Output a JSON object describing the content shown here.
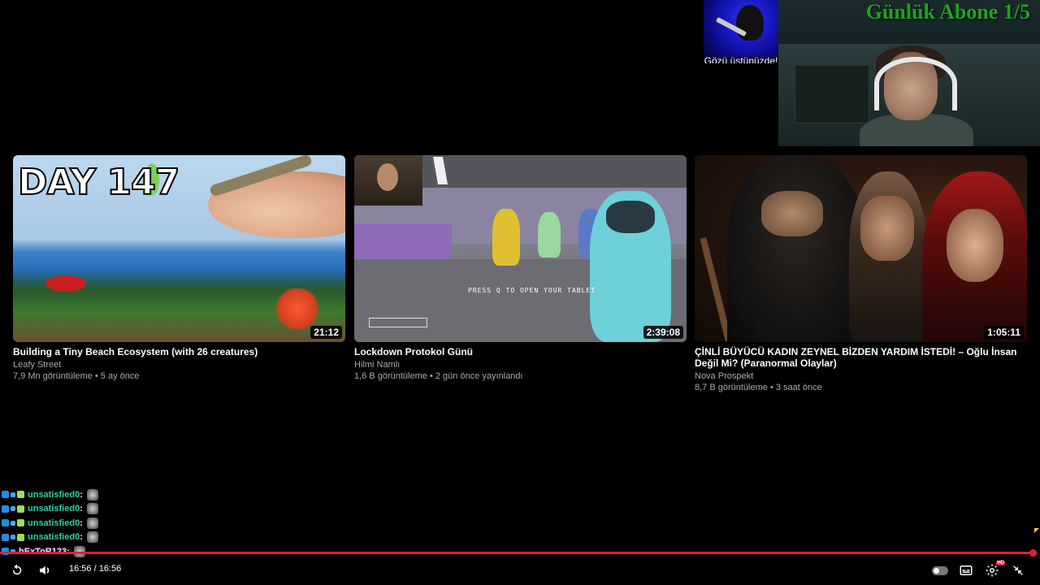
{
  "overlay": {
    "alert_caption": "Gözü üstünüzde!",
    "goal_text": "Günlük Abone 1/5"
  },
  "videos": [
    {
      "thumb_text": "DAY 147",
      "duration": "21:12",
      "title": "Building a Tiny Beach Ecosystem (with 26 creatures)",
      "channel": "Leafy Street",
      "meta": "7,9 Mn görüntüleme • 5 ay önce"
    },
    {
      "thumb_text": "PRESS Q TO OPEN YOUR TABLET",
      "duration": "2:39:08",
      "title": "Lockdown Protokol Günü",
      "channel": "Hilmi Namlı",
      "meta": "1,6 B görüntüleme • 2 gün önce yayınlandı"
    },
    {
      "duration": "1:05:11",
      "title": "ÇİNLİ BÜYÜCÜ KADIN ZEYNEL BİZDEN YARDIM İSTEDİ! – Oğlu İnsan Değil Mi? (Paranormal Olaylar)",
      "channel": "Nova Prospekt",
      "meta": "8,7 B görüntüleme • 3 saat önce"
    }
  ],
  "chat": [
    {
      "user": "unsatisfied0"
    },
    {
      "user": "unsatisfied0"
    },
    {
      "user": "unsatisfied0"
    },
    {
      "user": "unsatisfied0"
    },
    {
      "user": "hExToR123"
    }
  ],
  "player": {
    "time": "16:56 / 16:56",
    "progress_fraction": 1.0,
    "icons": [
      "replay-icon",
      "volume-icon",
      "autoplay-toggle",
      "subtitles-icon",
      "settings-icon",
      "exit-fullscreen-icon"
    ],
    "accent_color": "#e0203a"
  }
}
